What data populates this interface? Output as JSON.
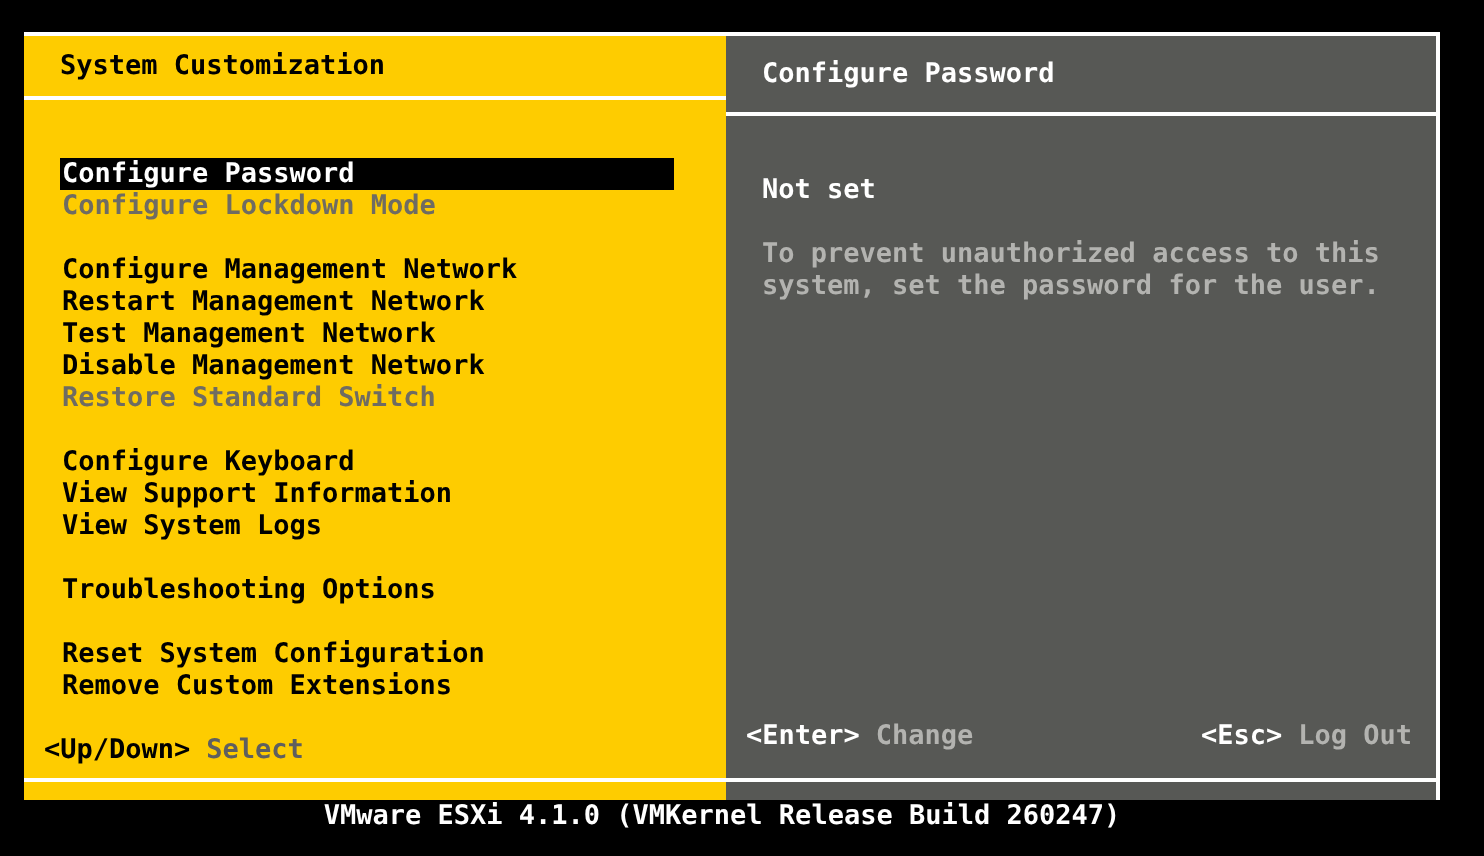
{
  "left_panel": {
    "title": "System Customization",
    "groups": [
      {
        "items": [
          {
            "label": "Configure Password",
            "selected": true,
            "disabled": false
          },
          {
            "label": "Configure Lockdown Mode",
            "selected": false,
            "disabled": true
          }
        ]
      },
      {
        "items": [
          {
            "label": "Configure Management Network",
            "selected": false,
            "disabled": false
          },
          {
            "label": "Restart Management Network",
            "selected": false,
            "disabled": false
          },
          {
            "label": "Test Management Network",
            "selected": false,
            "disabled": false
          },
          {
            "label": "Disable Management Network",
            "selected": false,
            "disabled": false
          },
          {
            "label": "Restore Standard Switch",
            "selected": false,
            "disabled": true
          }
        ]
      },
      {
        "items": [
          {
            "label": "Configure Keyboard",
            "selected": false,
            "disabled": false
          },
          {
            "label": "View Support Information",
            "selected": false,
            "disabled": false
          },
          {
            "label": "View System Logs",
            "selected": false,
            "disabled": false
          }
        ]
      },
      {
        "items": [
          {
            "label": "Troubleshooting Options",
            "selected": false,
            "disabled": false
          }
        ]
      },
      {
        "items": [
          {
            "label": "Reset System Configuration",
            "selected": false,
            "disabled": false
          },
          {
            "label": "Remove Custom Extensions",
            "selected": false,
            "disabled": false
          }
        ]
      }
    ],
    "hints": [
      {
        "key": "<Up/Down>",
        "action": "Select"
      }
    ]
  },
  "right_panel": {
    "title": "Configure Password",
    "status": "Not set",
    "description": "To prevent unauthorized access to this system, set the password for the user.",
    "hints": [
      {
        "key": "<Enter>",
        "action": "Change"
      },
      {
        "key": "<Esc>",
        "action": "Log Out"
      }
    ]
  },
  "footer": "VMware ESXi 4.1.0 (VMKernel Release Build 260247)"
}
